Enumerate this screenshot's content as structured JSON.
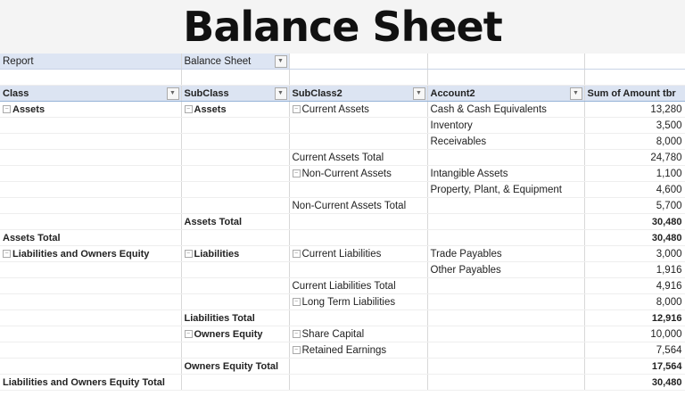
{
  "title": "Balance Sheet",
  "filter": {
    "label": "Report",
    "value": "Balance Sheet"
  },
  "headers": [
    "Class",
    "SubClass",
    "SubClass2",
    "Account2",
    "Sum of Amount tbr"
  ],
  "rows": [
    {
      "c1": "Assets",
      "c2": "Assets",
      "c3": "Current Assets",
      "c4": "Cash & Cash Equivalents",
      "v": "13,280",
      "e1": 1,
      "e2": 1,
      "e3": 1,
      "b1": 1,
      "b2": 1
    },
    {
      "c4": "Inventory",
      "v": "3,500"
    },
    {
      "c4": "Receivables",
      "v": "8,000"
    },
    {
      "c3": "Current Assets Total",
      "v": "24,780"
    },
    {
      "c3": "Non-Current Assets",
      "c4": "Intangible Assets",
      "v": "1,100",
      "e3": 1
    },
    {
      "c4": "Property, Plant, & Equipment",
      "v": "4,600"
    },
    {
      "c3": "Non-Current Assets Total",
      "v": "5,700"
    },
    {
      "c2": "Assets Total",
      "v": "30,480",
      "b2": 1,
      "bv": 1,
      "t": 2
    },
    {
      "c1": "Assets Total",
      "v": "30,480",
      "b1": 1,
      "bv": 1,
      "t": 1
    },
    {
      "c1": "Liabilities and Owners Equity",
      "c2": "Liabilities",
      "c3": "Current Liabilities",
      "c4": "Trade Payables",
      "v": "3,000",
      "e1": 1,
      "e2": 1,
      "e3": 1,
      "b1": 1,
      "b2": 1,
      "t": 1
    },
    {
      "c4": "Other Payables",
      "v": "1,916"
    },
    {
      "c3": "Current Liabilities Total",
      "v": "4,916"
    },
    {
      "c3": "Long Term Liabilities",
      "v": "8,000",
      "e3": 1
    },
    {
      "c2": "Liabilities Total",
      "v": "12,916",
      "b2": 1,
      "bv": 1
    },
    {
      "c2": "Owners Equity",
      "c3": "Share Capital",
      "v": "10,000",
      "e2": 1,
      "e3": 1,
      "b2": 1
    },
    {
      "c3": "Retained Earnings",
      "v": "7,564",
      "e3": 1
    },
    {
      "c2": "Owners Equity Total",
      "v": "17,564",
      "b2": 1,
      "bv": 1
    },
    {
      "c1": "Liabilities and Owners Equity Total",
      "v": "30,480",
      "b1": 1,
      "bv": 1,
      "t": 1
    }
  ]
}
